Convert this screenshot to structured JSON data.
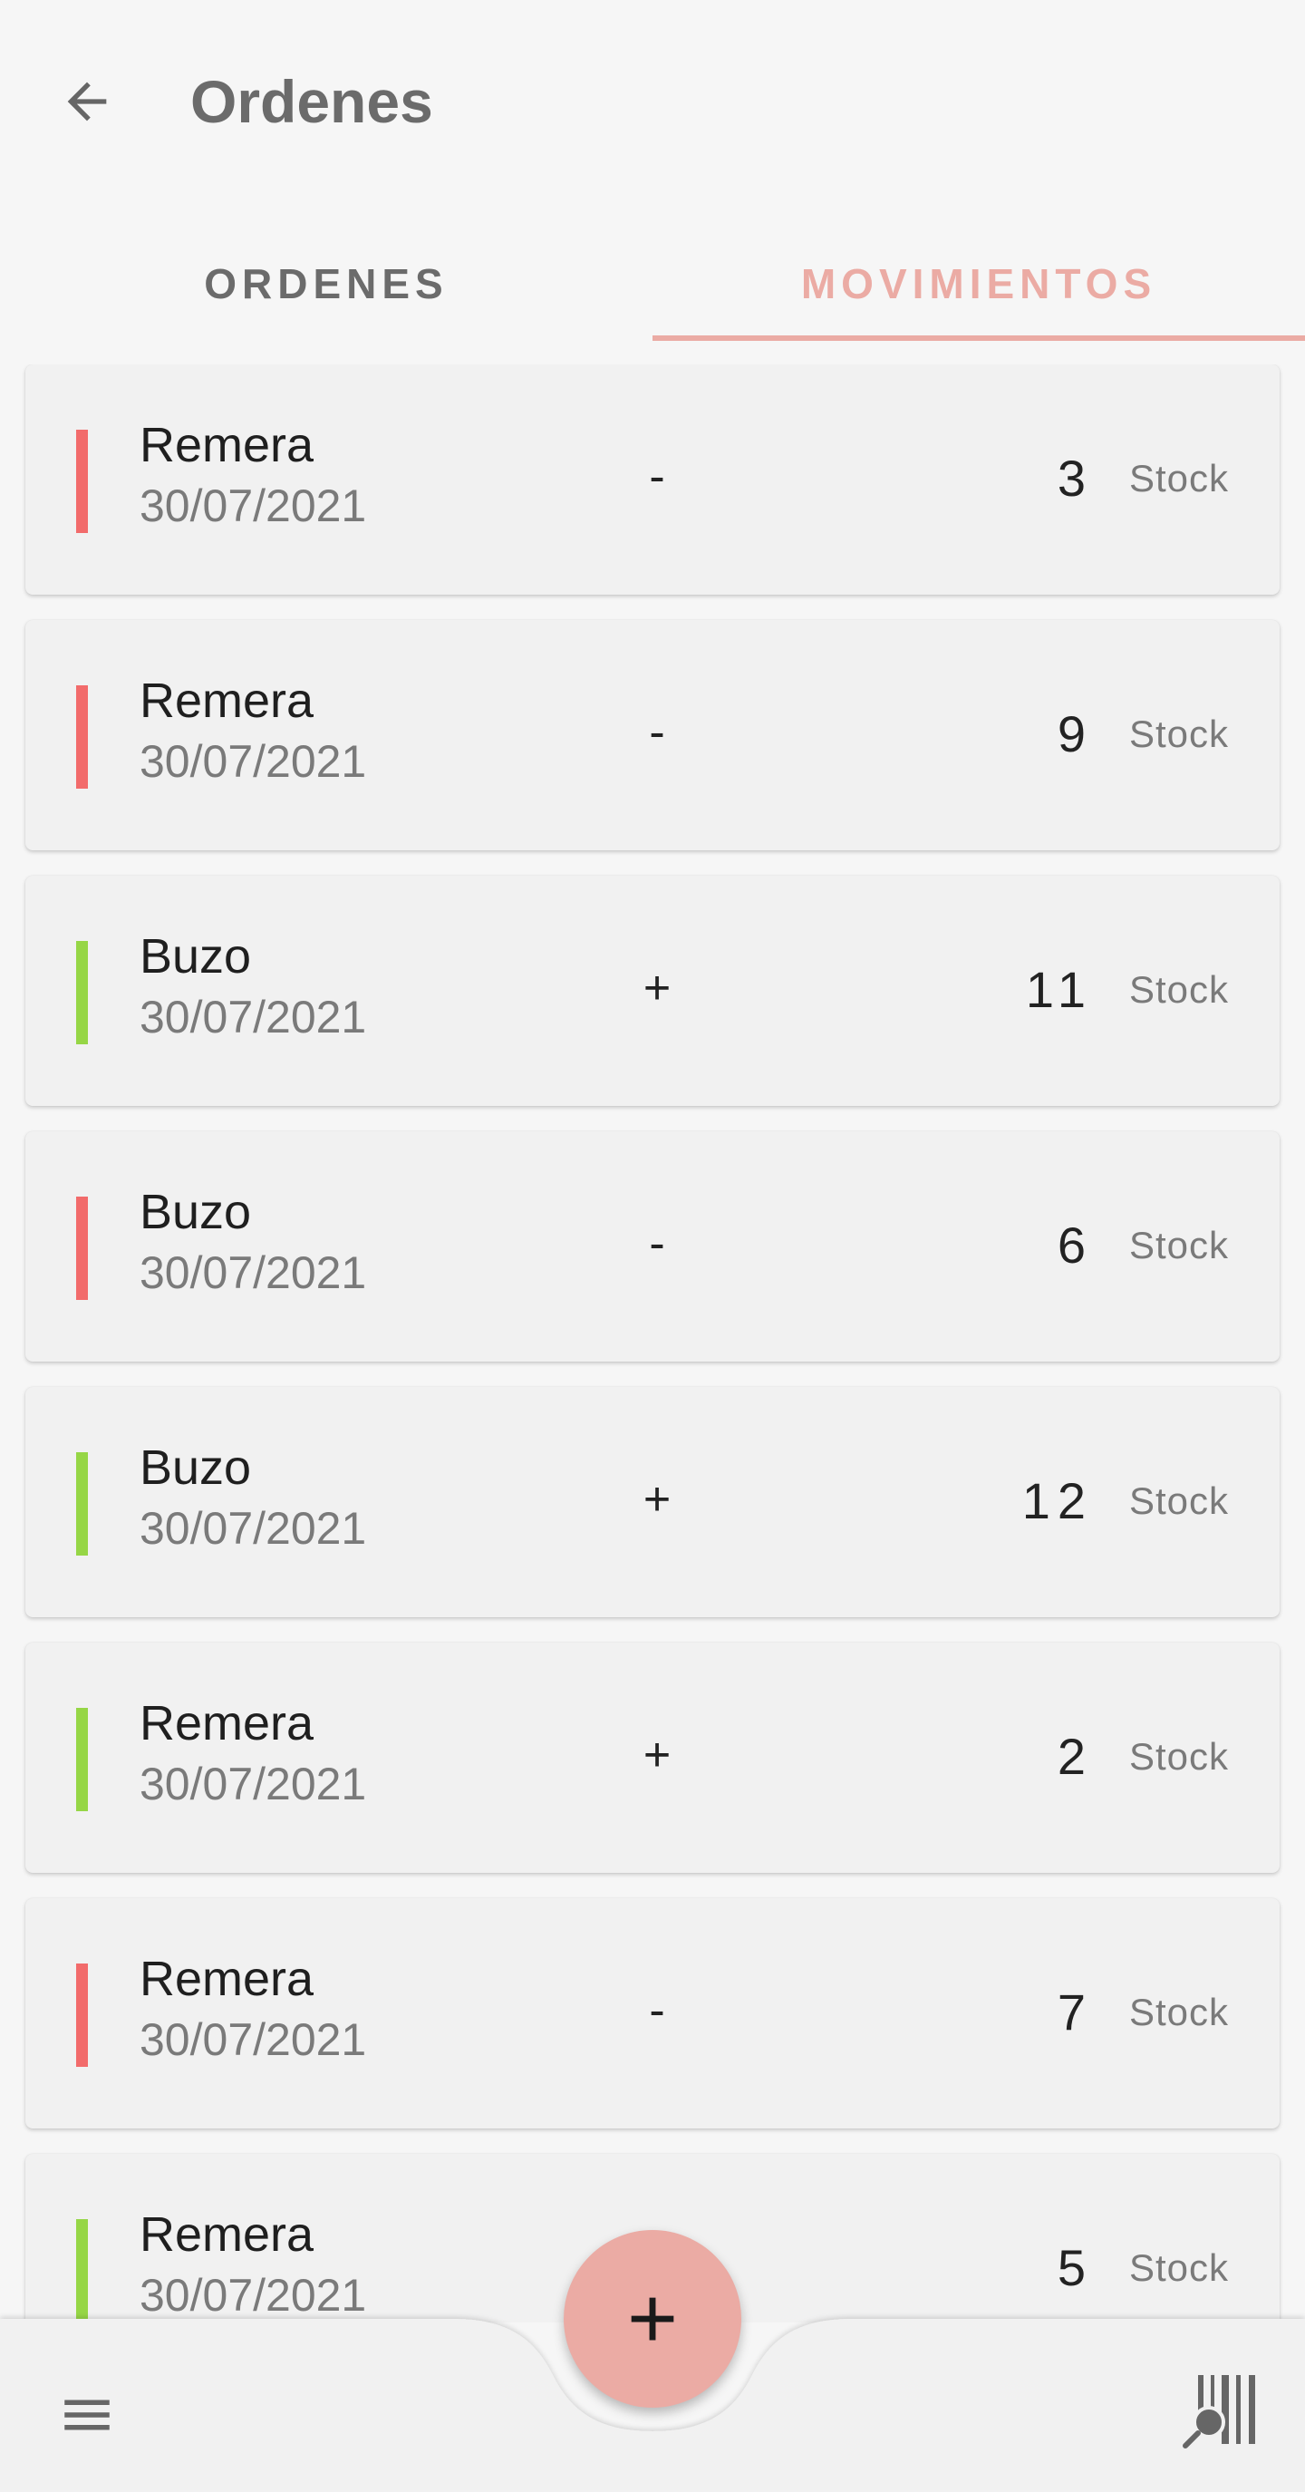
{
  "appbar": {
    "title": "Ordenes",
    "back_icon": "arrow-left-icon"
  },
  "tabs": [
    {
      "label": "ORDENES",
      "active": false
    },
    {
      "label": "MOVIMIENTOS",
      "active": true
    }
  ],
  "colors": {
    "accent": "#ebaba4",
    "outgoing": "#f26b6b",
    "incoming": "#96d646"
  },
  "movements": [
    {
      "product": "Remera",
      "date": "30/07/2021",
      "sign": "-",
      "quantity": "3",
      "unit": "Stock",
      "direction": "out"
    },
    {
      "product": "Remera",
      "date": "30/07/2021",
      "sign": "-",
      "quantity": "9",
      "unit": "Stock",
      "direction": "out"
    },
    {
      "product": "Buzo",
      "date": "30/07/2021",
      "sign": "+",
      "quantity": "11",
      "unit": "Stock",
      "direction": "in"
    },
    {
      "product": "Buzo",
      "date": "30/07/2021",
      "sign": "-",
      "quantity": "6",
      "unit": "Stock",
      "direction": "out"
    },
    {
      "product": "Buzo",
      "date": "30/07/2021",
      "sign": "+",
      "quantity": "12",
      "unit": "Stock",
      "direction": "in"
    },
    {
      "product": "Remera",
      "date": "30/07/2021",
      "sign": "+",
      "quantity": "2",
      "unit": "Stock",
      "direction": "in"
    },
    {
      "product": "Remera",
      "date": "30/07/2021",
      "sign": "-",
      "quantity": "7",
      "unit": "Stock",
      "direction": "out"
    },
    {
      "product": "Remera",
      "date": "30/07/2021",
      "sign": "+",
      "quantity": "5",
      "unit": "Stock",
      "direction": "in"
    }
  ],
  "bottom_bar": {
    "menu_icon": "hamburger-menu-icon",
    "fab_icon": "plus-icon",
    "fab_glyph": "+",
    "scan_icon": "barcode-scan-icon"
  }
}
